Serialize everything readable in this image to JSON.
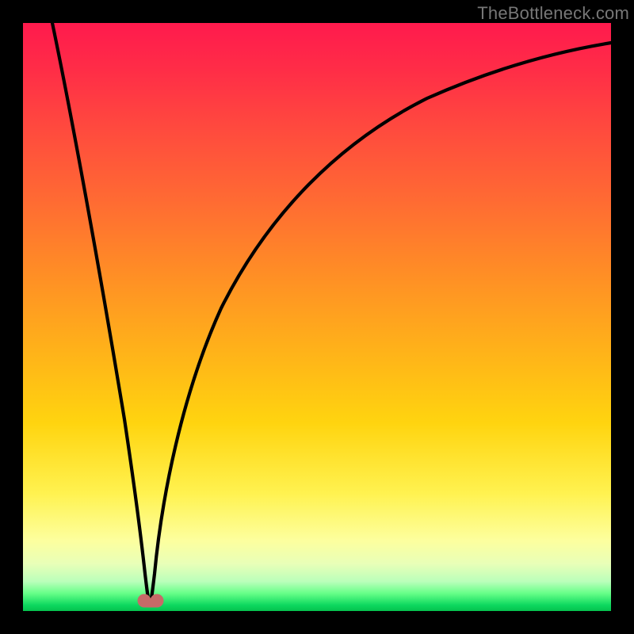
{
  "watermark": "TheBottleneck.com",
  "colors": {
    "curve": "#000000",
    "marker_fill": "#c76a68",
    "marker_stroke": "#c76a68"
  },
  "chart_data": {
    "type": "line",
    "title": "",
    "xlabel": "",
    "ylabel": "",
    "xlim": [
      0,
      1
    ],
    "ylim": [
      0,
      1
    ],
    "series": [
      {
        "name": "bottleneck-curve",
        "x": [
          0.0,
          0.03,
          0.06,
          0.09,
          0.12,
          0.15,
          0.18,
          0.2,
          0.21,
          0.215,
          0.22,
          0.23,
          0.25,
          0.28,
          0.32,
          0.38,
          0.46,
          0.56,
          0.68,
          0.82,
          0.98
        ],
        "y": [
          1.0,
          0.87,
          0.74,
          0.61,
          0.48,
          0.35,
          0.2,
          0.07,
          0.015,
          0.01,
          0.015,
          0.07,
          0.21,
          0.36,
          0.49,
          0.61,
          0.72,
          0.8,
          0.86,
          0.9,
          0.93
        ]
      }
    ],
    "markers": [
      {
        "name": "min-marker-left",
        "x": 0.206,
        "y": 0.013
      },
      {
        "name": "min-marker-right",
        "x": 0.228,
        "y": 0.013
      }
    ]
  }
}
